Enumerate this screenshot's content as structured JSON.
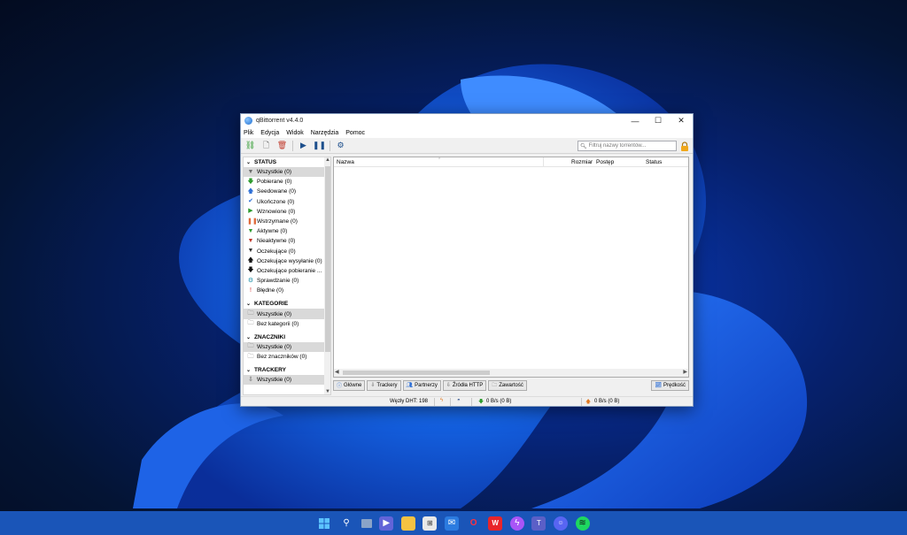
{
  "window": {
    "title": "qBittorrent v4.4.0",
    "min": "—",
    "max": "☐",
    "close": "✕"
  },
  "menu": [
    "Plik",
    "Edycja",
    "Widok",
    "Narzędzia",
    "Pomoc"
  ],
  "search": {
    "placeholder": "Filtruj nazwy torrentów..."
  },
  "sidebar": {
    "status_title": "STATUS",
    "status_items": [
      {
        "label": "Wszystkie (0)",
        "icon": "filter-icon",
        "glyph": "▼",
        "color": "#6b6b6b"
      },
      {
        "label": "Pobierane (0)",
        "icon": "arrow-down-icon",
        "glyph": "🡇",
        "color": "#2e9b2e"
      },
      {
        "label": "Seedowane (0)",
        "icon": "arrow-up-icon",
        "glyph": "🡅",
        "color": "#2d6fd6"
      },
      {
        "label": "Ukończone (0)",
        "icon": "checkmark-icon",
        "glyph": "✔",
        "color": "#2d6fd6"
      },
      {
        "label": "Wznowione (0)",
        "icon": "play-icon",
        "glyph": "▶",
        "color": "#2e9b2e"
      },
      {
        "label": "Wstrzymane (0)",
        "icon": "pause-icon",
        "glyph": "❚❚",
        "color": "#e06a3a"
      },
      {
        "label": "Aktywne (0)",
        "icon": "filter-icon",
        "glyph": "▼",
        "color": "#2e9b2e"
      },
      {
        "label": "Nieaktywne (0)",
        "icon": "filter-icon",
        "glyph": "▼",
        "color": "#c0392b"
      },
      {
        "label": "Oczekujące (0)",
        "icon": "filter-icon",
        "glyph": "▼",
        "color": "#333"
      },
      {
        "label": "Oczekujące wysyłanie (0)",
        "icon": "arrow-up-icon",
        "glyph": "🡅",
        "color": "#111"
      },
      {
        "label": "Oczekujące pobieranie ...",
        "icon": "arrow-down-icon",
        "glyph": "🡇",
        "color": "#111"
      },
      {
        "label": "Sprawdzanie (0)",
        "icon": "gear-icon",
        "glyph": "⚙",
        "color": "#1d8fa8"
      },
      {
        "label": "Błędne (0)",
        "icon": "exclamation-icon",
        "glyph": "!",
        "color": "#d12020"
      }
    ],
    "categories_title": "KATEGORIE",
    "categories": [
      {
        "label": "Wszystkie (0)",
        "icon": "folder-icon"
      },
      {
        "label": "Bez kategorii (0)",
        "icon": "folder-icon"
      }
    ],
    "tags_title": "ZNACZNIKI",
    "tags": [
      {
        "label": "Wszystkie (0)",
        "icon": "folder-icon"
      },
      {
        "label": "Bez znaczników (0)",
        "icon": "folder-icon"
      }
    ],
    "trackers_title": "TRACKERY",
    "trackers": [
      {
        "label": "Wszystkie (0)",
        "icon": "tracker-icon"
      }
    ]
  },
  "table": {
    "columns": [
      "Nazwa",
      "Rozmiar",
      "Postęp",
      "Status"
    ]
  },
  "tabs": [
    {
      "label": "Główne",
      "icon": "info-icon"
    },
    {
      "label": "Trackery",
      "icon": "tracker-icon"
    },
    {
      "label": "Partnerzy",
      "icon": "peers-icon"
    },
    {
      "label": "Źródła HTTP",
      "icon": "http-sources-icon"
    },
    {
      "label": "Zawartość",
      "icon": "folder-icon"
    }
  ],
  "speed_button": "Prędkość",
  "statusbar": {
    "dht": "Węzły DHT: 198",
    "down": "0 B/s (0 B)",
    "up": "0 B/s (0 B)"
  }
}
